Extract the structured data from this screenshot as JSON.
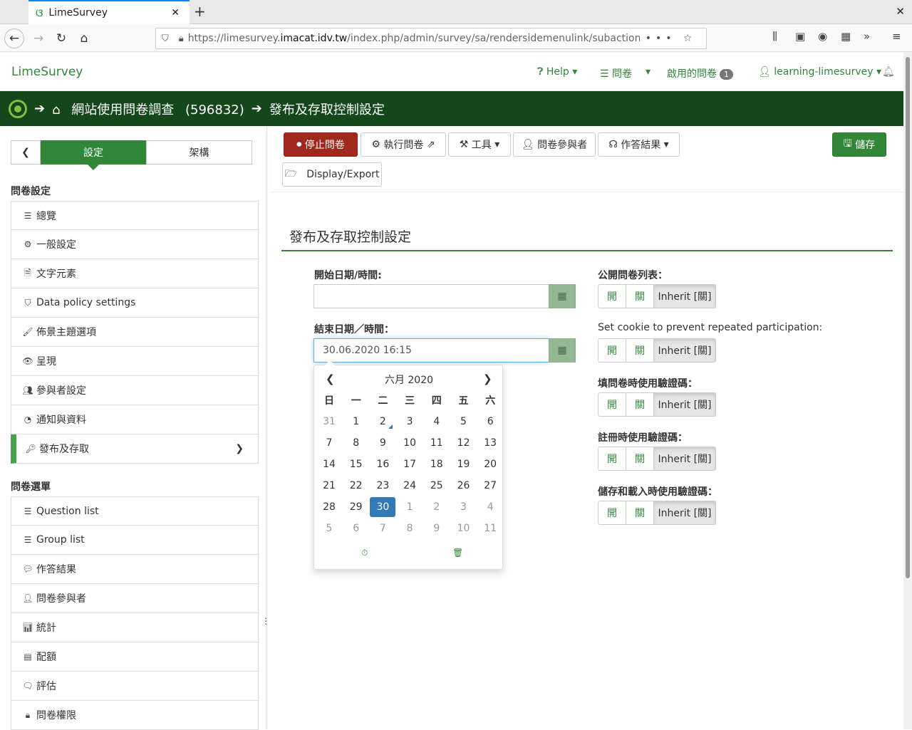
{
  "browser": {
    "tab_title": "LimeSurvey",
    "url_prefix": "https://limesurvey.",
    "url_domain": "imacat.idv.tw",
    "url_path": "/index.php/admin/survey/sa/rendersidemenulink/subaction/pub"
  },
  "header": {
    "brand": "LimeSurvey",
    "help": "Help",
    "surveys": "問卷",
    "active_surveys": "啟用的問卷",
    "active_count": "1",
    "user": "learning-limesurvey"
  },
  "breadcrumb": {
    "survey": "網站使用問卷調查",
    "survey_id": "(596832)",
    "page": "發布及存取控制設定"
  },
  "sidebar": {
    "tab_settings": "設定",
    "tab_structure": "架構",
    "section1": "問卷設定",
    "items1": [
      {
        "label": "總覽",
        "icon": "list-icon"
      },
      {
        "label": "一般設定",
        "icon": "gears-icon"
      },
      {
        "label": "文字元素",
        "icon": "file-text-icon"
      },
      {
        "label": "Data policy settings",
        "icon": "shield-icon"
      },
      {
        "label": "佈景主題選項",
        "icon": "paint-brush-icon"
      },
      {
        "label": "呈現",
        "icon": "eye-slash-icon"
      },
      {
        "label": "參與者設定",
        "icon": "users-icon"
      },
      {
        "label": "通知與資料",
        "icon": "feed-icon"
      },
      {
        "label": "發布及存取",
        "icon": "key-icon"
      }
    ],
    "section2": "問卷選單",
    "items2": [
      {
        "label": "Question list",
        "icon": "list-icon"
      },
      {
        "label": "Group list",
        "icon": "list-icon"
      },
      {
        "label": "作答結果",
        "icon": "comment-icon"
      },
      {
        "label": "問卷參與者",
        "icon": "user-icon"
      },
      {
        "label": "統計",
        "icon": "bar-chart-icon"
      },
      {
        "label": "配額",
        "icon": "tasks-icon"
      },
      {
        "label": "評估",
        "icon": "comment-o-icon"
      },
      {
        "label": "問卷權限",
        "icon": "lock-icon"
      }
    ]
  },
  "toolbar": {
    "stop": "停止問卷",
    "execute": "執行問卷",
    "tools": "工具",
    "participants": "問卷參與者",
    "responses": "作答結果",
    "save": "儲存",
    "display_export": "Display/Export"
  },
  "form": {
    "title": "發布及存取控制設定",
    "start_label": "開始日期/時間:",
    "start_value": "",
    "end_label": "結束日期／時間：",
    "end_value": "30.06.2020 16:15",
    "toggles": [
      {
        "label": "公開問卷列表：",
        "on": "開",
        "off": "關",
        "inherit": "Inherit [關]"
      },
      {
        "label": "Set cookie to prevent repeated participation:",
        "on": "開",
        "off": "關",
        "inherit": "Inherit [關]"
      },
      {
        "label": "填問卷時使用驗證碼：",
        "on": "開",
        "off": "關",
        "inherit": "Inherit [關]"
      },
      {
        "label": "註冊時使用驗證碼：",
        "on": "開",
        "off": "關",
        "inherit": "Inherit [關]"
      },
      {
        "label": "儲存和載入時使用驗證碼：",
        "on": "開",
        "off": "關",
        "inherit": "Inherit [關]"
      }
    ]
  },
  "datepicker": {
    "month_label": "六月 2020",
    "weekdays": [
      "日",
      "一",
      "二",
      "三",
      "四",
      "五",
      "六"
    ],
    "weeks": [
      [
        "31",
        "1",
        "2",
        "3",
        "4",
        "5",
        "6"
      ],
      [
        "7",
        "8",
        "9",
        "10",
        "11",
        "12",
        "13"
      ],
      [
        "14",
        "15",
        "16",
        "17",
        "18",
        "19",
        "20"
      ],
      [
        "21",
        "22",
        "23",
        "24",
        "25",
        "26",
        "27"
      ],
      [
        "28",
        "29",
        "30",
        "1",
        "2",
        "3",
        "4"
      ],
      [
        "5",
        "6",
        "7",
        "8",
        "9",
        "10",
        "11"
      ]
    ],
    "selected": "30"
  }
}
